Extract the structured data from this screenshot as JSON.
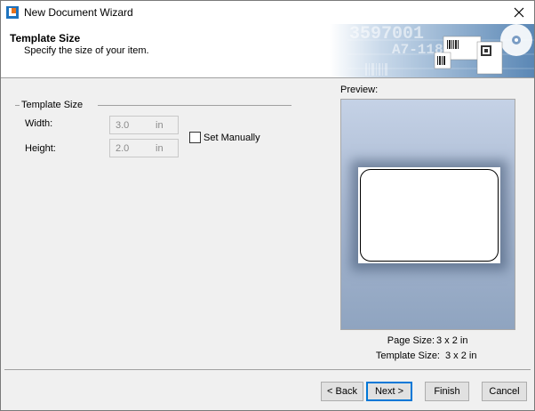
{
  "window": {
    "title": "New Document Wizard"
  },
  "header": {
    "title": "Template Size",
    "subtitle": "Specify the size of your item."
  },
  "banner": {
    "big_number": "3597001",
    "code": "A7-118"
  },
  "template_size_group": {
    "label": "Template Size",
    "width_label": "Width:",
    "width_value": "3.0",
    "width_unit": "in",
    "height_label": "Height:",
    "height_value": "2.0",
    "height_unit": "in",
    "set_manually_label": "Set Manually",
    "set_manually_checked": false
  },
  "preview": {
    "label": "Preview:",
    "page_size_label": "Page Size:",
    "page_size_value": "3 x 2 in",
    "template_size_label": "Template Size:",
    "template_size_value": "3 x 2 in"
  },
  "buttons": {
    "back": "< Back",
    "next": "Next >",
    "finish": "Finish",
    "cancel": "Cancel"
  },
  "colors": {
    "accent": "#0078d7",
    "app_icon_orange": "#e8731c",
    "app_icon_blue": "#1e73be"
  }
}
